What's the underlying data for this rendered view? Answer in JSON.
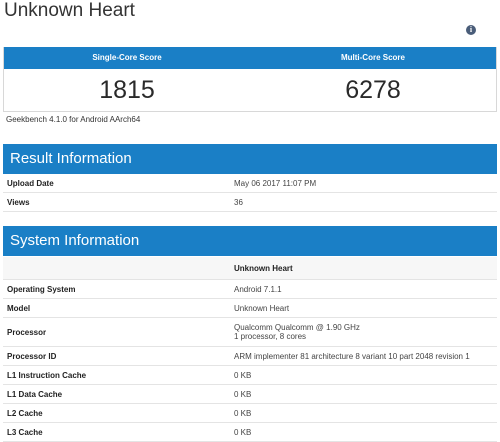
{
  "page": {
    "title": "Unknown Heart"
  },
  "scores": {
    "single_label": "Single-Core Score",
    "single_value": "1815",
    "multi_label": "Multi-Core Score",
    "multi_value": "6278"
  },
  "platform_text": "Geekbench 4.1.0 for Android AArch64",
  "result_info": {
    "heading": "Result Information",
    "rows": [
      {
        "key": "Upload Date",
        "value": "May 06 2017 11:07 PM"
      },
      {
        "key": "Views",
        "value": "36"
      }
    ]
  },
  "system_info": {
    "heading": "System Information",
    "column_header": "Unknown Heart",
    "rows": [
      {
        "key": "Operating System",
        "value": "Android 7.1.1"
      },
      {
        "key": "Model",
        "value": "Unknown Heart"
      },
      {
        "key": "Processor",
        "value": "Qualcomm Qualcomm @ 1.90 GHz",
        "value2": "1 processor, 8 cores"
      },
      {
        "key": "Processor ID",
        "value": "ARM implementer 81 architecture 8 variant 10 part 2048 revision 1"
      },
      {
        "key": "L1 Instruction Cache",
        "value": "0 KB"
      },
      {
        "key": "L1 Data Cache",
        "value": "0 KB"
      },
      {
        "key": "L2 Cache",
        "value": "0 KB"
      },
      {
        "key": "L3 Cache",
        "value": "0 KB"
      }
    ]
  },
  "icons": {
    "info": "info-icon"
  }
}
